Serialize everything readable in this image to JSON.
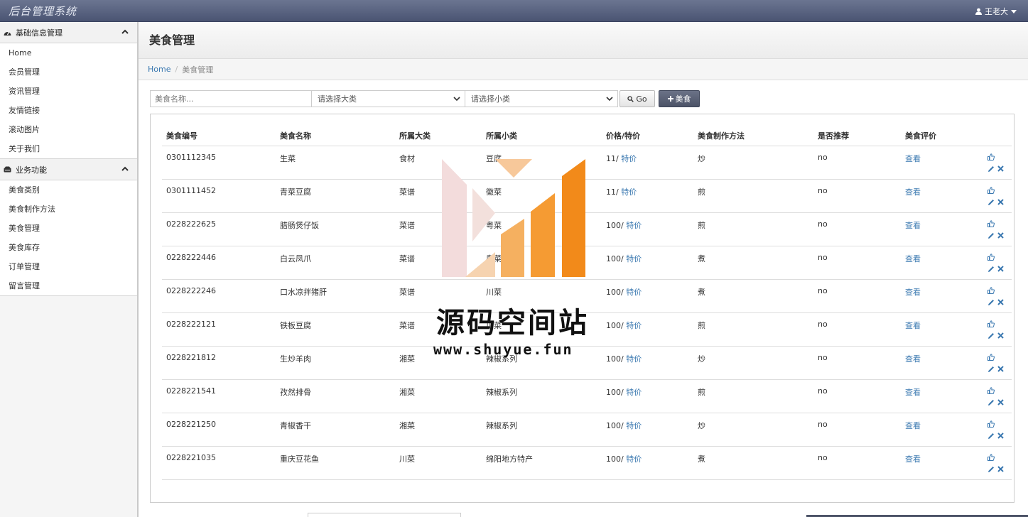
{
  "app": {
    "title": "后台管理系统",
    "user": "王老大"
  },
  "sidebar": {
    "sections": [
      {
        "title": "基础信息管理",
        "items": [
          "Home",
          "会员管理",
          "资讯管理",
          "友情链接",
          "滚动图片",
          "关于我们"
        ]
      },
      {
        "title": "业务功能",
        "items": [
          "美食类别",
          "美食制作方法",
          "美食管理",
          "美食库存",
          "订单管理",
          "留言管理"
        ]
      }
    ]
  },
  "page": {
    "title": "美食管理",
    "breadcrumb": {
      "home": "Home",
      "current": "美食管理"
    }
  },
  "search": {
    "placeholder": "美食名称...",
    "category_select": "请选择大类",
    "subcategory_select": "请选择小类",
    "go_label": "Go",
    "add_label": "美食"
  },
  "table": {
    "headers": [
      "美食编号",
      "美食名称",
      "所属大类",
      "所属小类",
      "价格/特价",
      "美食制作方法",
      "是否推荐",
      "美食评价"
    ],
    "special_label": "特价",
    "review_label": "查看",
    "rows": [
      {
        "id": "0301112345",
        "name": "生菜",
        "category": "食材",
        "subcategory": "豆腐",
        "price": "11/",
        "method": "炒",
        "recommend": "no"
      },
      {
        "id": "0301111452",
        "name": "青菜豆腐",
        "category": "菜谱",
        "subcategory": "徽菜",
        "price": "11/",
        "method": "煎",
        "recommend": "no"
      },
      {
        "id": "0228222625",
        "name": "腊肠煲仔饭",
        "category": "菜谱",
        "subcategory": "粤菜",
        "price": "100/",
        "method": "煎",
        "recommend": "no"
      },
      {
        "id": "0228222446",
        "name": "白云凤爪",
        "category": "菜谱",
        "subcategory": "粤菜",
        "price": "100/",
        "method": "煮",
        "recommend": "no"
      },
      {
        "id": "0228222246",
        "name": "口水凉拌猪肝",
        "category": "菜谱",
        "subcategory": "川菜",
        "price": "100/",
        "method": "煮",
        "recommend": "no"
      },
      {
        "id": "0228222121",
        "name": "铁板豆腐",
        "category": "菜谱",
        "subcategory": "川菜",
        "price": "100/",
        "method": "煎",
        "recommend": "no"
      },
      {
        "id": "0228221812",
        "name": "生炒羊肉",
        "category": "湘菜",
        "subcategory": "辣椒系列",
        "price": "100/",
        "method": "炒",
        "recommend": "no"
      },
      {
        "id": "0228221541",
        "name": "孜然排骨",
        "category": "湘菜",
        "subcategory": "辣椒系列",
        "price": "100/",
        "method": "煎",
        "recommend": "no"
      },
      {
        "id": "0228221250",
        "name": "青椒香干",
        "category": "湘菜",
        "subcategory": "辣椒系列",
        "price": "100/",
        "method": "炒",
        "recommend": "no"
      },
      {
        "id": "0228221035",
        "name": "重庆豆花鱼",
        "category": "川菜",
        "subcategory": "绵阳地方特产",
        "price": "100/",
        "method": "煮",
        "recommend": "no"
      }
    ]
  },
  "watermark": {
    "name": "源码空间站",
    "url": "www.shuyue.fun"
  },
  "colors": {
    "topbar": "#4a5472",
    "link": "#3a78b0",
    "accent": "#f28a1a"
  }
}
